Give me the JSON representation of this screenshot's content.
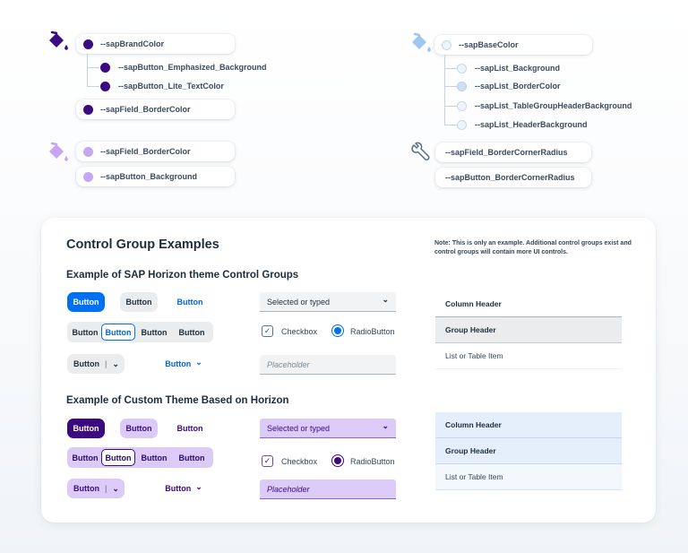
{
  "tokens": {
    "brand_group": {
      "root": "--sapBrandColor",
      "children": [
        "--sapButton_Emphasized_Background",
        "--sapButton_Lite_TextColor"
      ],
      "extra": "--sapField_BorderColor",
      "color": "#3b0a80"
    },
    "lilac_group": {
      "items": [
        "--sapField_BorderColor",
        "--sapButton_Background"
      ],
      "color": "#c6a6f3"
    },
    "base_group": {
      "root": "--sapBaseColor",
      "children": [
        "--sapList_Background",
        "--sapList_BorderColor",
        "--sapList_TableGroupHeaderBackground",
        "--sapList_HeaderBackground"
      ],
      "color": "#eef4fb"
    },
    "radius_group": {
      "items": [
        "--sapField_BorderCornerRadius",
        "--sapButton_BorderCornerRadius"
      ]
    },
    "icons": {
      "paint_bucket": "paint-bucket-icon",
      "wrench": "wrench-icon"
    }
  },
  "card": {
    "title": "Control Group Examples",
    "note": "Note: This is only an example. Additional control groups exist and control groups will contain more UI controls.",
    "horizon": {
      "heading": "Example of SAP Horizon theme Control Groups",
      "accent": "#0070f2",
      "buttons": [
        "Button",
        "Button",
        "Button"
      ],
      "segmented": [
        "Button",
        "Button",
        "Button",
        "Button"
      ],
      "split_button": "Button",
      "menu_button": "Button",
      "select_value": "Selected or typed",
      "checkbox_label": "Checkbox",
      "radio_label": "RadioButton",
      "input_placeholder": "Placeholder",
      "list": {
        "column_header": "Column Header",
        "group_header": "Group Header",
        "item": "List or Table Item"
      }
    },
    "custom": {
      "heading": "Example of Custom Theme Based on Horizon",
      "accent": "#3b0a80",
      "buttons": [
        "Button",
        "Button",
        "Button"
      ],
      "segmented": [
        "Button",
        "Button",
        "Button",
        "Button"
      ],
      "split_button": "Button",
      "menu_button": "Button",
      "select_value": "Selected or typed",
      "checkbox_label": "Checkbox",
      "radio_label": "RadioButton",
      "input_placeholder": "Placeholder",
      "list": {
        "column_header": "Column Header",
        "group_header": "Group Header",
        "item": "List or Table Item"
      }
    }
  }
}
